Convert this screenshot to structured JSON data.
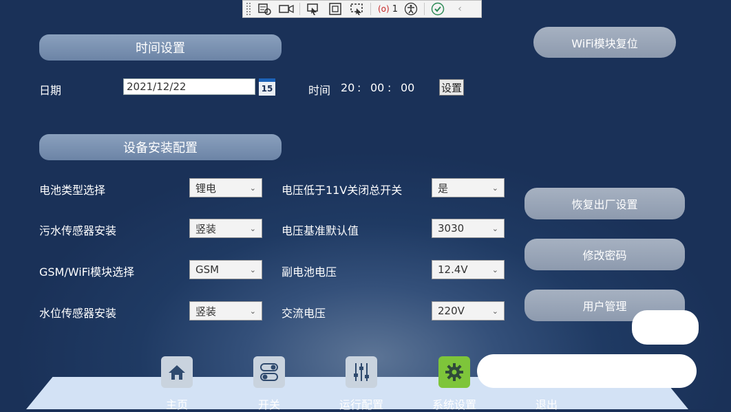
{
  "toolbar": {
    "error_count_label": "(o)",
    "error_count": "1"
  },
  "time_settings": {
    "title": "时间设置",
    "date_label": "日期",
    "date_value": "2021/12/22",
    "calendar_icon_text": "15",
    "time_label": "时间",
    "hour": "20",
    "minute": "00",
    "second": "00",
    "sep": ":",
    "set_button": "设置"
  },
  "wifi_reset_button": "WiFi模块复位",
  "install_config": {
    "title": "设备安装配置",
    "left": [
      {
        "label": "电池类型选择",
        "value": "锂电"
      },
      {
        "label": "污水传感器安装",
        "value": "竖装"
      },
      {
        "label": "GSM/WiFi模块选择",
        "value": "GSM"
      },
      {
        "label": "水位传感器安装",
        "value": "竖装"
      }
    ],
    "right": [
      {
        "label": "电压低于11V关闭总开关",
        "value": "是"
      },
      {
        "label": "电压基准默认值",
        "value": "3030"
      },
      {
        "label": "副电池电压",
        "value": "12.4V"
      },
      {
        "label": "交流电压",
        "value": "220V"
      }
    ]
  },
  "side_buttons": {
    "factory_reset": "恢复出厂设置",
    "change_password": "修改密码",
    "user_management": "用户管理"
  },
  "nav": {
    "home": "主页",
    "switch": "开关",
    "run_config": "运行配置",
    "system_settings": "系统设置",
    "exit": "退出"
  },
  "colors": {
    "accent_green": "#7ec53a",
    "background": "#1f3a63"
  }
}
